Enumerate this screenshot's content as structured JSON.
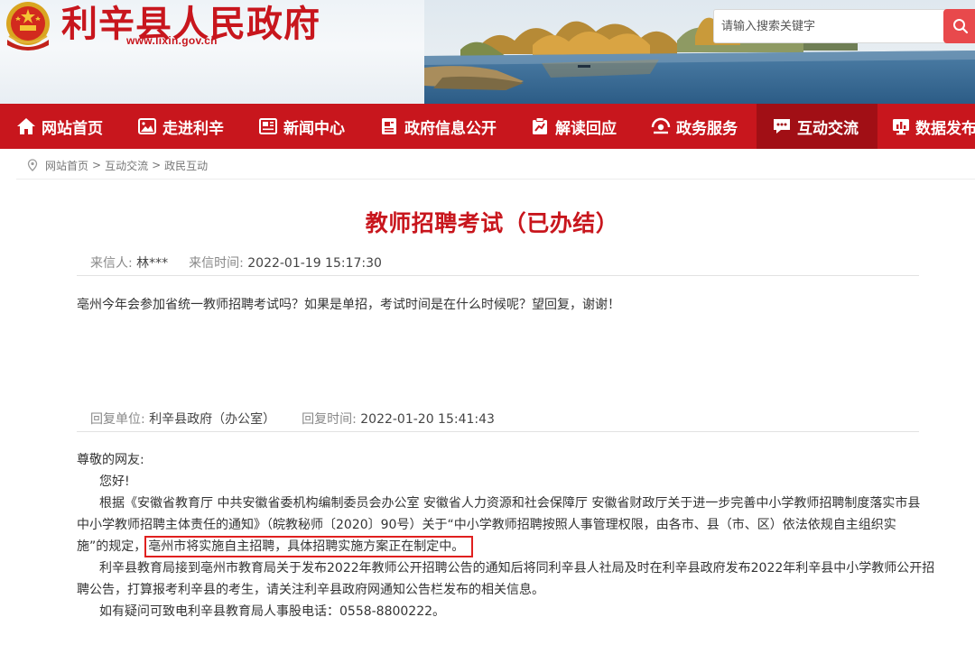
{
  "header": {
    "site_title": "利辛县人民政府",
    "site_url": "www.lixin.gov.cn",
    "search_placeholder": "请输入搜索关键字",
    "search_icon": "search-icon",
    "emblem_icon": "national-emblem-icon"
  },
  "nav": {
    "items": [
      {
        "label": "网站首页",
        "icon": "home-icon"
      },
      {
        "label": "走进利辛",
        "icon": "image-icon"
      },
      {
        "label": "新闻中心",
        "icon": "newspaper-icon"
      },
      {
        "label": "政府信息公开",
        "icon": "document-icon"
      },
      {
        "label": "解读回应",
        "icon": "chart-icon"
      },
      {
        "label": "政务服务",
        "icon": "service-icon"
      },
      {
        "label": "互动交流",
        "icon": "chat-icon",
        "active": true
      },
      {
        "label": "数据发布",
        "icon": "data-icon"
      }
    ]
  },
  "breadcrumb": {
    "items": [
      "网站首页",
      "互动交流",
      "政民互动"
    ],
    "separator": ">"
  },
  "article": {
    "title": "教师招聘考试（已办结）",
    "sender_label": "来信人:",
    "sender": "林***",
    "sent_time_label": "来信时间:",
    "sent_time": "2022-01-19 15:17:30",
    "question": "亳州今年会参加省统一教师招聘考试吗？如果是单招，考试时间是在什么时候呢？望回复，谢谢！",
    "reply_unit_label": "回复单位:",
    "reply_unit": "利辛县政府（办公室）",
    "reply_time_label": "回复时间:",
    "reply_time": "2022-01-20 15:41:43",
    "reply": {
      "greeting": "尊敬的网友:",
      "hello": "您好!",
      "p1_line1": "根据《安徽省教育厅 中共安徽省委机构编制委员会办公室 安徽省人力资源和社会保障厅 安徽省财政厅关于进一步完善中小学教师招聘制度落实市县",
      "p1_line2": "中小学教师招聘主体责任的通知》（皖教秘师〔2020〕90号）关于“中小学教师招聘按照人事管理权限，由各市、县（市、区）依法依规自主组织实",
      "p1_line3_pre": "施”的规定，",
      "p1_line3_highlight": "亳州市将实施自主招聘，具体招聘实施方案正在制定中。",
      "p2_line1": "利辛县教育局接到亳州市教育局关于发布2022年教师公开招聘公告的通知后将同利辛县人社局及时在利辛县政府发布2022年利辛县中小学教师公开招",
      "p2_line2": "聘公告，打算报考利辛县的考生，请关注利辛县政府网通知公告栏发布的相关信息。",
      "p3": "如有疑问可致电利辛县教育局人事股电话：0558-8800222。"
    }
  },
  "colors": {
    "brand_red": "#c8161d",
    "nav_active": "#a10f15",
    "highlight_border": "#e0201f",
    "search_button": "#e8494c"
  }
}
